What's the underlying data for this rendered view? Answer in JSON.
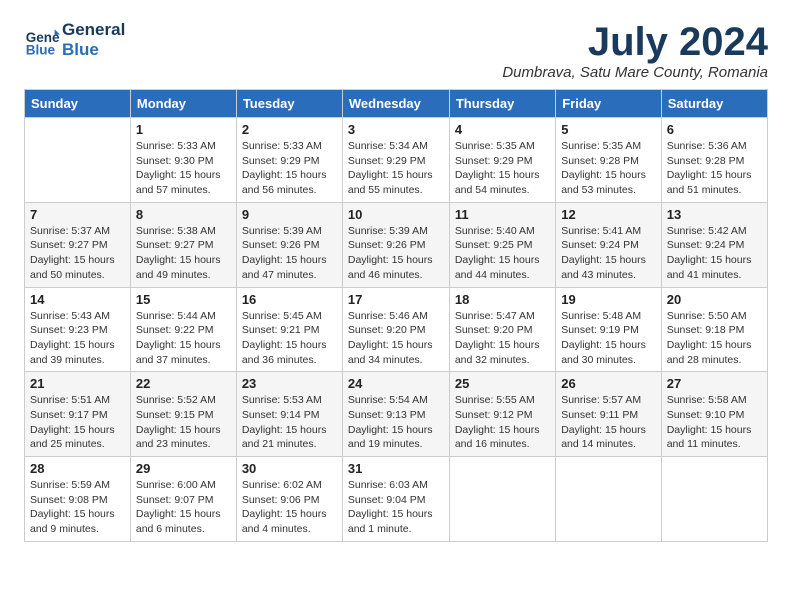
{
  "logo": {
    "line1": "General",
    "line2": "Blue"
  },
  "title": "July 2024",
  "subtitle": "Dumbrava, Satu Mare County, Romania",
  "days_of_week": [
    "Sunday",
    "Monday",
    "Tuesday",
    "Wednesday",
    "Thursday",
    "Friday",
    "Saturday"
  ],
  "weeks": [
    [
      {
        "day": "",
        "detail": ""
      },
      {
        "day": "1",
        "detail": "Sunrise: 5:33 AM\nSunset: 9:30 PM\nDaylight: 15 hours\nand 57 minutes."
      },
      {
        "day": "2",
        "detail": "Sunrise: 5:33 AM\nSunset: 9:29 PM\nDaylight: 15 hours\nand 56 minutes."
      },
      {
        "day": "3",
        "detail": "Sunrise: 5:34 AM\nSunset: 9:29 PM\nDaylight: 15 hours\nand 55 minutes."
      },
      {
        "day": "4",
        "detail": "Sunrise: 5:35 AM\nSunset: 9:29 PM\nDaylight: 15 hours\nand 54 minutes."
      },
      {
        "day": "5",
        "detail": "Sunrise: 5:35 AM\nSunset: 9:28 PM\nDaylight: 15 hours\nand 53 minutes."
      },
      {
        "day": "6",
        "detail": "Sunrise: 5:36 AM\nSunset: 9:28 PM\nDaylight: 15 hours\nand 51 minutes."
      }
    ],
    [
      {
        "day": "7",
        "detail": "Sunrise: 5:37 AM\nSunset: 9:27 PM\nDaylight: 15 hours\nand 50 minutes."
      },
      {
        "day": "8",
        "detail": "Sunrise: 5:38 AM\nSunset: 9:27 PM\nDaylight: 15 hours\nand 49 minutes."
      },
      {
        "day": "9",
        "detail": "Sunrise: 5:39 AM\nSunset: 9:26 PM\nDaylight: 15 hours\nand 47 minutes."
      },
      {
        "day": "10",
        "detail": "Sunrise: 5:39 AM\nSunset: 9:26 PM\nDaylight: 15 hours\nand 46 minutes."
      },
      {
        "day": "11",
        "detail": "Sunrise: 5:40 AM\nSunset: 9:25 PM\nDaylight: 15 hours\nand 44 minutes."
      },
      {
        "day": "12",
        "detail": "Sunrise: 5:41 AM\nSunset: 9:24 PM\nDaylight: 15 hours\nand 43 minutes."
      },
      {
        "day": "13",
        "detail": "Sunrise: 5:42 AM\nSunset: 9:24 PM\nDaylight: 15 hours\nand 41 minutes."
      }
    ],
    [
      {
        "day": "14",
        "detail": "Sunrise: 5:43 AM\nSunset: 9:23 PM\nDaylight: 15 hours\nand 39 minutes."
      },
      {
        "day": "15",
        "detail": "Sunrise: 5:44 AM\nSunset: 9:22 PM\nDaylight: 15 hours\nand 37 minutes."
      },
      {
        "day": "16",
        "detail": "Sunrise: 5:45 AM\nSunset: 9:21 PM\nDaylight: 15 hours\nand 36 minutes."
      },
      {
        "day": "17",
        "detail": "Sunrise: 5:46 AM\nSunset: 9:20 PM\nDaylight: 15 hours\nand 34 minutes."
      },
      {
        "day": "18",
        "detail": "Sunrise: 5:47 AM\nSunset: 9:20 PM\nDaylight: 15 hours\nand 32 minutes."
      },
      {
        "day": "19",
        "detail": "Sunrise: 5:48 AM\nSunset: 9:19 PM\nDaylight: 15 hours\nand 30 minutes."
      },
      {
        "day": "20",
        "detail": "Sunrise: 5:50 AM\nSunset: 9:18 PM\nDaylight: 15 hours\nand 28 minutes."
      }
    ],
    [
      {
        "day": "21",
        "detail": "Sunrise: 5:51 AM\nSunset: 9:17 PM\nDaylight: 15 hours\nand 25 minutes."
      },
      {
        "day": "22",
        "detail": "Sunrise: 5:52 AM\nSunset: 9:15 PM\nDaylight: 15 hours\nand 23 minutes."
      },
      {
        "day": "23",
        "detail": "Sunrise: 5:53 AM\nSunset: 9:14 PM\nDaylight: 15 hours\nand 21 minutes."
      },
      {
        "day": "24",
        "detail": "Sunrise: 5:54 AM\nSunset: 9:13 PM\nDaylight: 15 hours\nand 19 minutes."
      },
      {
        "day": "25",
        "detail": "Sunrise: 5:55 AM\nSunset: 9:12 PM\nDaylight: 15 hours\nand 16 minutes."
      },
      {
        "day": "26",
        "detail": "Sunrise: 5:57 AM\nSunset: 9:11 PM\nDaylight: 15 hours\nand 14 minutes."
      },
      {
        "day": "27",
        "detail": "Sunrise: 5:58 AM\nSunset: 9:10 PM\nDaylight: 15 hours\nand 11 minutes."
      }
    ],
    [
      {
        "day": "28",
        "detail": "Sunrise: 5:59 AM\nSunset: 9:08 PM\nDaylight: 15 hours\nand 9 minutes."
      },
      {
        "day": "29",
        "detail": "Sunrise: 6:00 AM\nSunset: 9:07 PM\nDaylight: 15 hours\nand 6 minutes."
      },
      {
        "day": "30",
        "detail": "Sunrise: 6:02 AM\nSunset: 9:06 PM\nDaylight: 15 hours\nand 4 minutes."
      },
      {
        "day": "31",
        "detail": "Sunrise: 6:03 AM\nSunset: 9:04 PM\nDaylight: 15 hours\nand 1 minute."
      },
      {
        "day": "",
        "detail": ""
      },
      {
        "day": "",
        "detail": ""
      },
      {
        "day": "",
        "detail": ""
      }
    ]
  ]
}
